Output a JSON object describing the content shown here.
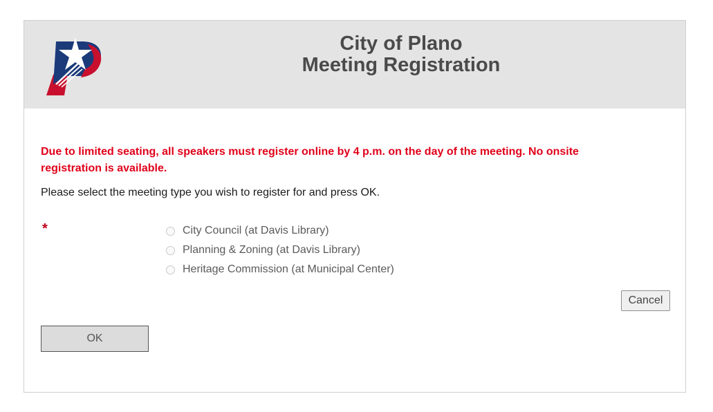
{
  "header": {
    "logo_icon": "city-of-plano-p-star-logo",
    "title_line1": "City of Plano",
    "title_line2": "Meeting Registration",
    "background_color": "#e4e4e4"
  },
  "notice": {
    "text": "Due to limited seating, all speakers must register online by 4 p.m. on the day of the meeting. No onsite registration is available.",
    "color": "#e0001a"
  },
  "instructions": "Please select the meeting type you wish to register for and press OK.",
  "form": {
    "required_marker": "*",
    "meeting_types": [
      {
        "label": "City Council (at Davis Library)",
        "selected": false
      },
      {
        "label": "Planning & Zoning (at Davis Library)",
        "selected": false
      },
      {
        "label": "Heritage Commission (at Municipal Center)",
        "selected": false
      }
    ]
  },
  "buttons": {
    "cancel_label": "Cancel",
    "ok_label": "OK"
  }
}
